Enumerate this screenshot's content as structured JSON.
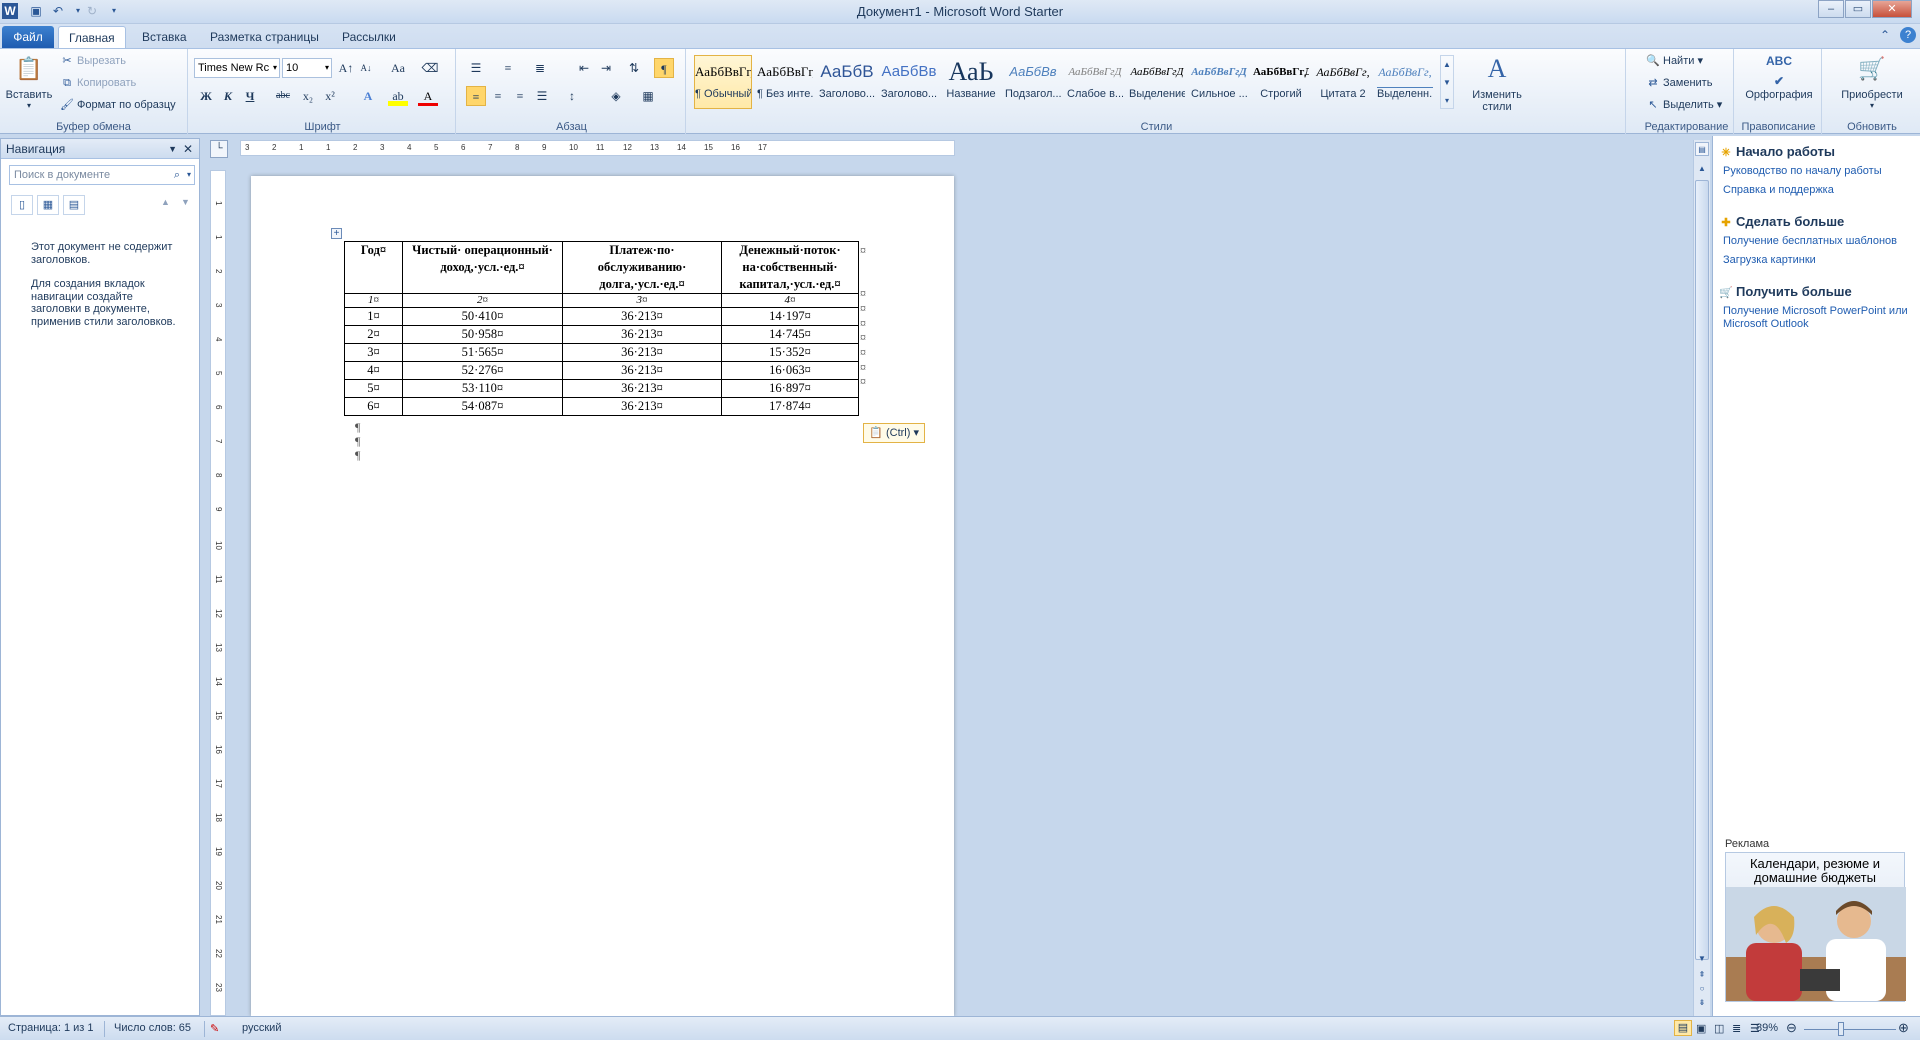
{
  "window": {
    "title": "Документ1  -  Microsoft Word Starter"
  },
  "tabs": [
    "Файл",
    "Главная",
    "Вставка",
    "Разметка страницы",
    "Рассылки"
  ],
  "clipboard": {
    "paste": "Вставить",
    "cut": "Вырезать",
    "copy": "Копировать",
    "format_painter": "Формат по образцу",
    "label": "Буфер обмена"
  },
  "font": {
    "name": "Times New Rc",
    "size": "10",
    "label": "Шрифт",
    "bold": "Ж",
    "italic": "К",
    "underline": "Ч",
    "strike": "abc",
    "sub": "x₂",
    "sup": "x²",
    "grow": "A↑",
    "shrink": "A↓",
    "case": "Aa",
    "color_a": "A"
  },
  "paragraph": {
    "label": "Абзац",
    "pilcrow": "¶"
  },
  "styles": {
    "label": "Стили",
    "items": [
      {
        "preview": "АаБбВвГг,",
        "name": "¶ Обычный"
      },
      {
        "preview": "АаБбВвГг,",
        "name": "¶ Без инте..."
      },
      {
        "preview": "АаБбВ",
        "name": "Заголово..."
      },
      {
        "preview": "АаБбВв",
        "name": "Заголово..."
      },
      {
        "preview": "АаЬ",
        "name": "Название"
      },
      {
        "preview": "АаБбВв",
        "name": "Подзагол..."
      },
      {
        "preview": "АаБбВвГгД",
        "name": "Слабое в..."
      },
      {
        "preview": "АаБбВвГгД",
        "name": "Выделение"
      },
      {
        "preview": "АаБбВвГгД",
        "name": "Сильное ..."
      },
      {
        "preview": "АаБбВвГгД",
        "name": "Строгий"
      },
      {
        "preview": "АаБбВвГг,",
        "name": "Цитата 2"
      },
      {
        "preview": "АаБбВвГг,",
        "name": "Выделенн..."
      }
    ],
    "change": "Изменить стили"
  },
  "editing": {
    "label": "Редактирование",
    "find": "Найти",
    "replace": "Заменить",
    "select": "Выделить"
  },
  "proofing": {
    "label": "Правописание",
    "spelling": "Орфография",
    "icon_text": "ABC"
  },
  "upgrade": {
    "label": "Обновить",
    "purchase": "Приобрести"
  },
  "nav": {
    "title": "Навигация",
    "search_placeholder": "Поиск в документе",
    "message1": "Этот документ не содержит заголовков.",
    "message2": "Для создания вкладок навигации создайте заголовки в документе, применив стили заголовков."
  },
  "ruler": {
    "h_ticks": [
      "3",
      "2",
      "1",
      "1",
      "2",
      "3",
      "4",
      "5",
      "6",
      "7",
      "8",
      "9",
      "10",
      "11",
      "12",
      "13",
      "14",
      "15",
      "16",
      "17"
    ],
    "v_ticks": [
      "1",
      "1",
      "2",
      "3",
      "4",
      "5",
      "6",
      "7",
      "8",
      "9",
      "10",
      "11",
      "12",
      "13",
      "14",
      "15",
      "16",
      "17",
      "18",
      "19",
      "20",
      "21",
      "22",
      "23"
    ]
  },
  "table": {
    "headers": [
      "Год¤",
      "Чистый· операционный· доход,·усл.·ед.¤",
      "Платеж·по· обслуживанию· долга,·усл.·ед.¤",
      "Денежный·поток· на·собственный· капитал,·усл.·ед.¤"
    ],
    "numrow": [
      "1¤",
      "2¤",
      "3¤",
      "4¤"
    ],
    "rows": [
      [
        "1¤",
        "50·410¤",
        "36·213¤",
        "14·197¤"
      ],
      [
        "2¤",
        "50·958¤",
        "36·213¤",
        "14·745¤"
      ],
      [
        "3¤",
        "51·565¤",
        "36·213¤",
        "15·352¤"
      ],
      [
        "4¤",
        "52·276¤",
        "36·213¤",
        "16·063¤"
      ],
      [
        "5¤",
        "53·110¤",
        "36·213¤",
        "16·897¤"
      ],
      [
        "6¤",
        "54·087¤",
        "36·213¤",
        "17·874¤"
      ]
    ],
    "end_mark": "¤",
    "paste_options": "(Ctrl)"
  },
  "taskpane": {
    "start_title": "Начало работы",
    "start_links": [
      "Руководство по началу работы",
      "Справка и поддержка"
    ],
    "more_title": "Сделать больше",
    "more_links": [
      "Получение бесплатных шаблонов",
      "Загрузка картинки"
    ],
    "get_title": "Получить больше",
    "get_links": [
      "Получение Microsoft PowerPoint или Microsoft Outlook"
    ],
    "ad_label": "Реклама",
    "ad_text": "Календари, резюме и домашние бюджеты"
  },
  "status": {
    "page": "Страница: 1 из 1",
    "words": "Число слов: 65",
    "lang": "русский",
    "zoom": "89%"
  }
}
